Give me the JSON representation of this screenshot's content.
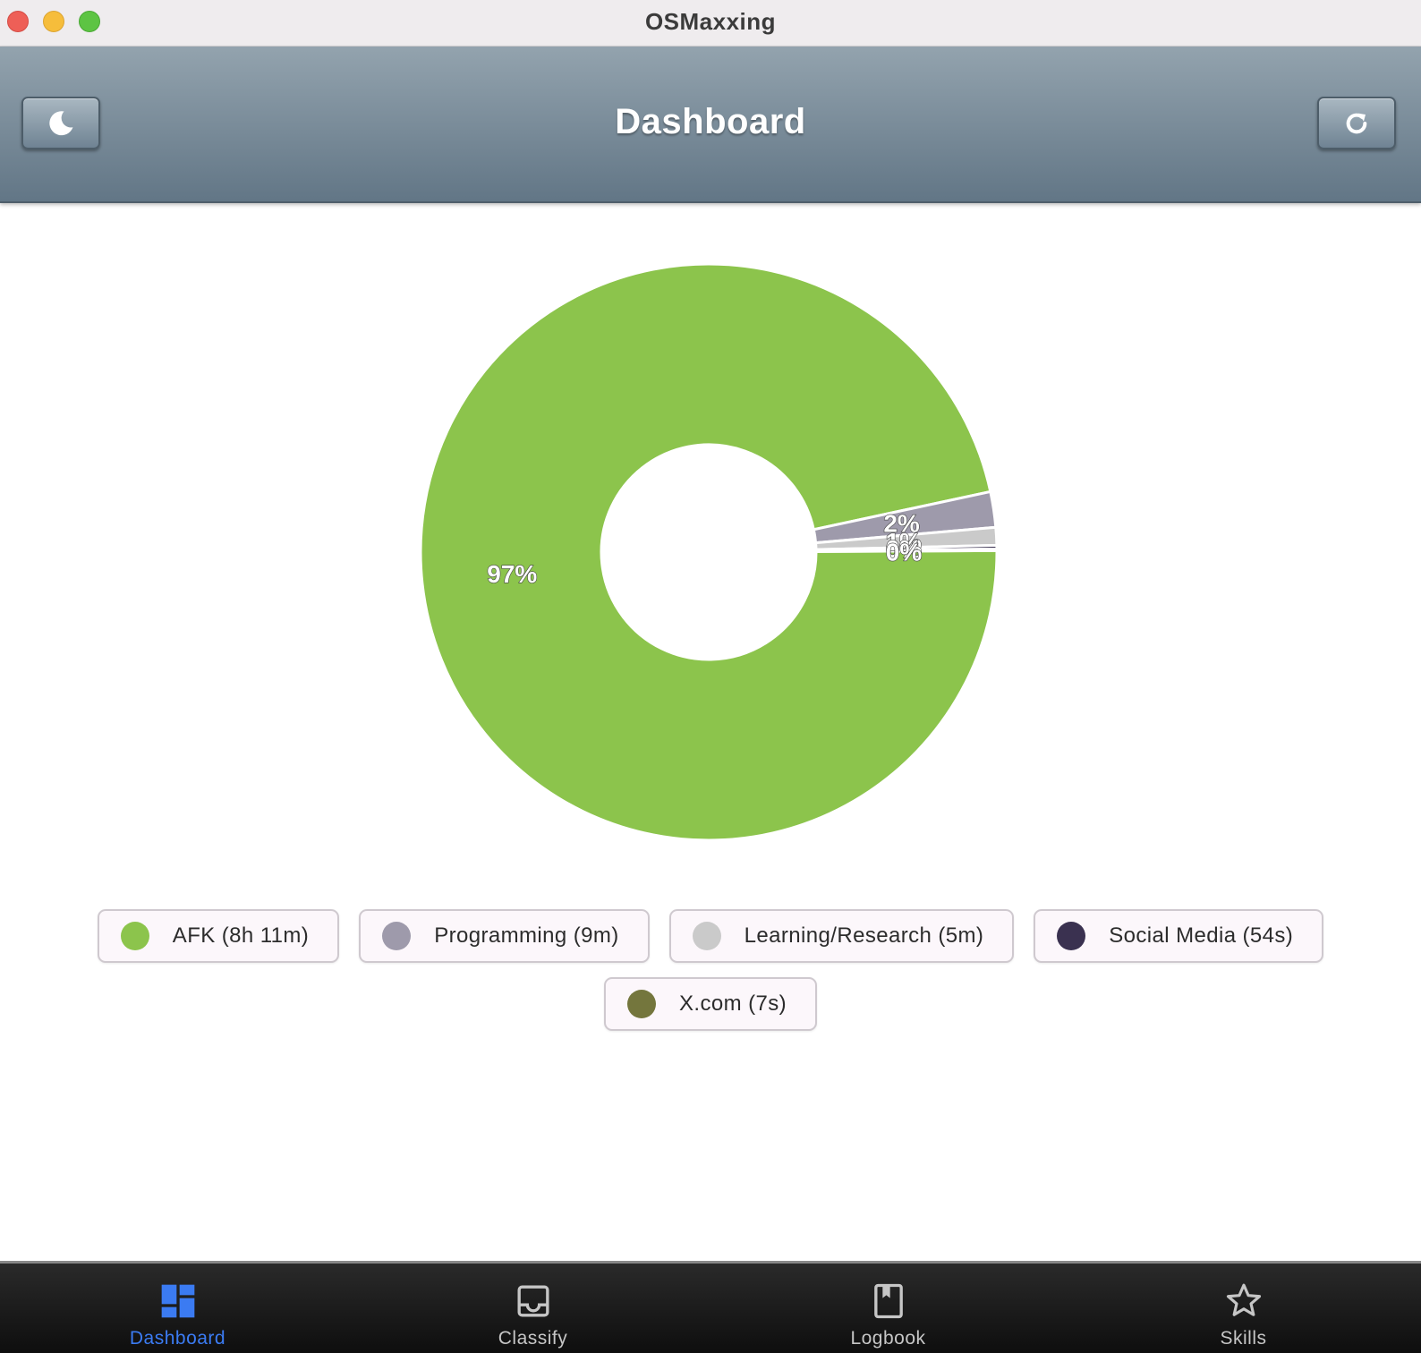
{
  "window": {
    "title": "OSMaxxing"
  },
  "header": {
    "title": "Dashboard",
    "left_button_icon": "moon-icon",
    "right_button_icon": "refresh-icon"
  },
  "chart_data": {
    "type": "pie",
    "donut": true,
    "slices": [
      {
        "label": "AFK (8h 11m)",
        "value": 97,
        "display": "97%",
        "color": "#8cc44c"
      },
      {
        "label": "Programming (9m)",
        "value": 2,
        "display": "2%",
        "color": "#9e9aab"
      },
      {
        "label": "Learning/Research (5m)",
        "value": 1,
        "display": "1%",
        "color": "#cacaca"
      },
      {
        "label": "Social Media (54s)",
        "value": 0.2,
        "display": "0%",
        "color": "#3a3150"
      },
      {
        "label": "X.com (7s)",
        "value": 0.03,
        "display": "0%",
        "color": "#74763d"
      }
    ]
  },
  "legend": {
    "rows": [
      [
        {
          "label": "AFK (8h 11m)",
          "color": "#8cc44c"
        },
        {
          "label": "Programming (9m)",
          "color": "#9e9aab"
        },
        {
          "label": "Learning/Research (5m)",
          "color": "#cacaca"
        },
        {
          "label": "Social Media (54s)",
          "color": "#3a3150"
        }
      ],
      [
        {
          "label": "X.com (7s)",
          "color": "#74763d"
        }
      ]
    ]
  },
  "nav": {
    "active_color": "#3b7bf2",
    "items": [
      {
        "label": "Dashboard",
        "icon": "dashboard-icon",
        "active": true
      },
      {
        "label": "Classify",
        "icon": "inbox-icon",
        "active": false
      },
      {
        "label": "Logbook",
        "icon": "book-icon",
        "active": false
      },
      {
        "label": "Skills",
        "icon": "star-icon",
        "active": false
      }
    ]
  }
}
